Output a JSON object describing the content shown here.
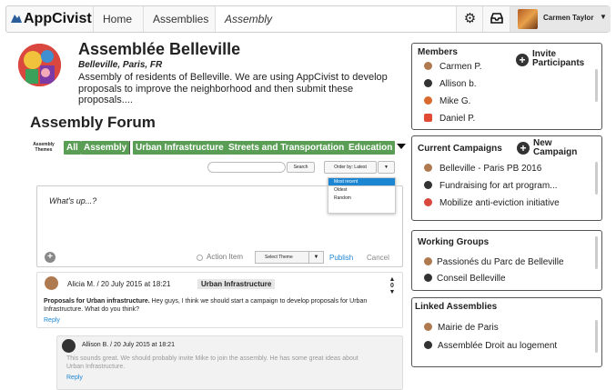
{
  "navbar": {
    "brand": "AppCivist",
    "items": [
      "Home",
      "Assemblies",
      "Assembly"
    ],
    "user_name": "Carmen Taylor"
  },
  "assembly": {
    "title": "Assemblée Belleville",
    "location": "Belleville, Paris, FR",
    "description": "Assembly of residents of Belleville. We are using AppCivist to develop proposals to improve the neighborhood and then submit these proposals...."
  },
  "forum": {
    "title": "Assembly Forum",
    "themes_label": "Assembly Themes",
    "themes": [
      "All",
      "Assembly",
      "Urban Infrastructure",
      "Streets and Transportation",
      "Education"
    ],
    "search_button": "Search",
    "order_label": "Order by: Latest",
    "order_options": [
      "Most recent",
      "Oldest",
      "Random"
    ],
    "composer": {
      "placeholder": "What's up...?",
      "action_item": "Action Item",
      "select_theme": "Select Theme",
      "publish": "Publish",
      "cancel": "Cancel"
    },
    "posts": [
      {
        "author": "Alicia M.",
        "date": "20 July 2015 at 18:21",
        "theme": "Urban Infrastructure",
        "title": "Proposals for Urban infrastructure.",
        "text": "Hey guys, I think we should start a campaign to develop proposals for Urban Infrastructure. What do you think?",
        "reply": "Reply",
        "votes": "0"
      }
    ],
    "replies": [
      {
        "author": "Allison B.",
        "date": "20 July 2015 at 18:21",
        "text": "This sounds great. We should probably invite Mike to join the assembly. He has some great ideas about Urban Infrastructure.",
        "reply": "Reply"
      }
    ]
  },
  "sidebar": {
    "members": {
      "title": "Members",
      "invite": "Invite Participants",
      "items": [
        "Carmen P.",
        "Allison b.",
        "Mike G.",
        "Daniel P."
      ]
    },
    "campaigns": {
      "title": "Current Campaigns",
      "new": "New Campaign",
      "items": [
        "Belleville - Paris PB 2016",
        "Fundraising for art program...",
        "Mobilize anti-eviction initiative"
      ]
    },
    "working_groups": {
      "title": "Working Groups",
      "items": [
        "Passionés du Parc de Belleville",
        "Conseil Belleville"
      ]
    },
    "linked_assemblies": {
      "title": "Linked Assemblies",
      "items": [
        "Mairie de Paris",
        "Assemblée Droit au logement"
      ]
    }
  },
  "colors": {
    "theme_tag": "#5a9e56",
    "link": "#1c86d3",
    "dropdown_active": "#1c86d3"
  }
}
